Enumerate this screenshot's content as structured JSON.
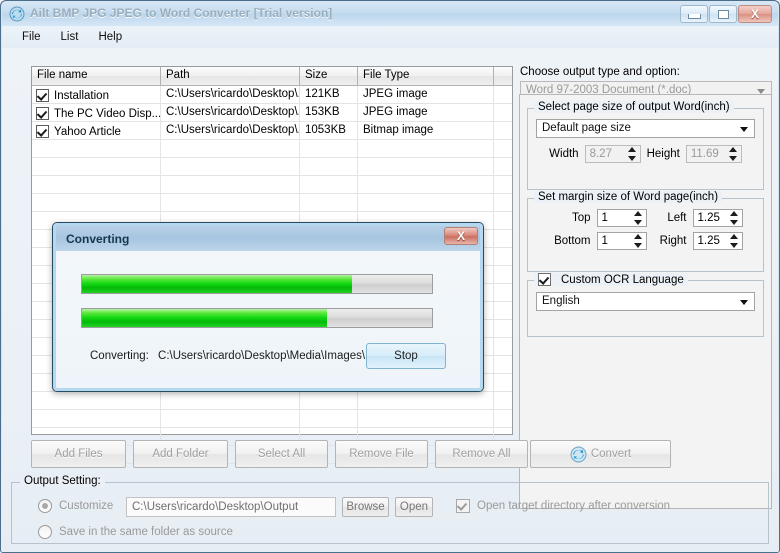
{
  "window": {
    "title": "Ailt BMP JPG JPEG to Word Converter [Trial version]",
    "icon": "convert-circular-arrows-icon",
    "minimize_label": "–",
    "maximize_label": "□",
    "close_label": "X"
  },
  "menubar": {
    "items": [
      {
        "label": "File"
      },
      {
        "label": "List"
      },
      {
        "label": "Help"
      }
    ]
  },
  "file_list": {
    "columns": [
      "File name",
      "Path",
      "Size",
      "File Type",
      ""
    ],
    "rows": [
      {
        "checked": true,
        "name": "Installation",
        "path": "C:\\Users\\ricardo\\Desktop\\...",
        "size": "121KB",
        "type": "JPEG image"
      },
      {
        "checked": true,
        "name": "The PC Video Disp...",
        "path": "C:\\Users\\ricardo\\Desktop\\...",
        "size": "153KB",
        "type": "JPEG image"
      },
      {
        "checked": true,
        "name": "Yahoo Article",
        "path": "C:\\Users\\ricardo\\Desktop\\...",
        "size": "1053KB",
        "type": "Bitmap image"
      }
    ]
  },
  "options": {
    "output_type_label": "Choose output type and option:",
    "output_type_value": "Word 97-2003 Document (*.doc)",
    "page_size_group": "Select page size of output Word(inch)",
    "page_size_value": "Default page size",
    "width_label": "Width",
    "width_value": "8.27",
    "height_label": "Height",
    "height_value": "11.69",
    "margin_group": "Set margin size of Word page(inch)",
    "top_label": "Top",
    "top_value": "1",
    "left_label": "Left",
    "left_value": "1.25",
    "bottom_label": "Bottom",
    "bottom_value": "1",
    "right_label": "Right",
    "right_value": "1.25",
    "ocr_group_label": "Custom OCR Language",
    "ocr_checked": true,
    "ocr_value": "English"
  },
  "toolbar": {
    "add_files": "Add Files",
    "add_folder": "Add Folder",
    "select_all": "Select All",
    "remove_file": "Remove File",
    "remove_all": "Remove All",
    "convert": "Convert",
    "convert_icon": "refresh-arrows-icon"
  },
  "output_setting": {
    "group_label": "Output Setting:",
    "customize_label": "Customize",
    "customize_selected": true,
    "path_value": "C:\\Users\\ricardo\\Desktop\\Output",
    "browse_label": "Browse",
    "open_label": "Open",
    "open_target_label": "Open target directory after conversion",
    "open_target_checked": true,
    "same_folder_label": "Save in the same folder as source",
    "same_folder_selected": false
  },
  "dialog": {
    "title": "Converting",
    "close_label": "X",
    "progress_overall_percent": 77,
    "progress_current_percent": 70,
    "status_prefix": "Converting:",
    "status_path": "C:\\Users\\ricardo\\Desktop\\Media\\Images\\In",
    "stop_label": "Stop"
  },
  "colors": {
    "progress_green": "#12d813",
    "dialog_title_blue": "#a8c6e1",
    "close_red": "#c9705f",
    "accent_blue": "#7fb3cf"
  }
}
